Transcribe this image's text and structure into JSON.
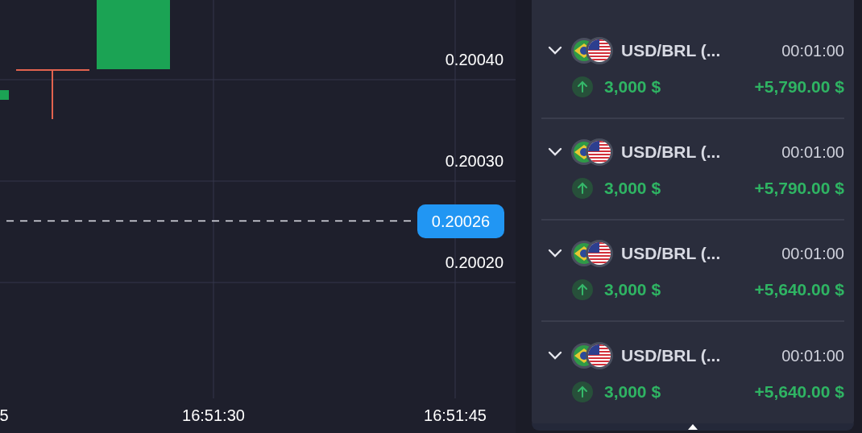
{
  "chart": {
    "y_labels": [
      "0.20040",
      "0.20030",
      "0.20020"
    ],
    "current_price": "0.20026",
    "x_labels": [
      "5",
      "16:51:30",
      "16:51:45"
    ]
  },
  "trades": [
    {
      "pair": "USD/BRL (...",
      "duration": "00:01:00",
      "kind": "up",
      "amount": "3,000 $",
      "profit": "+5,790.00 $",
      "expanded": false
    },
    {
      "pair": "USD/BRL (...",
      "duration": "00:01:00",
      "kind": "up",
      "amount": "3,000 $",
      "profit": "+5,790.00 $",
      "expanded": false
    },
    {
      "pair": "USD/BRL (...",
      "duration": "00:01:00",
      "kind": "up",
      "amount": "3,000 $",
      "profit": "+5,640.00 $",
      "expanded": false
    },
    {
      "pair": "USD/BRL (...",
      "duration": "00:01:00",
      "kind": "up",
      "amount": "3,000 $",
      "profit": "+5,640.00 $",
      "expanded": false
    }
  ]
}
